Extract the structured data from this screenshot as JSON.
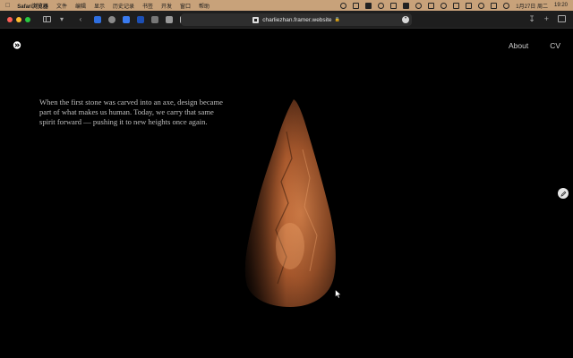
{
  "menubar": {
    "app_name": "Safari浏览器",
    "items": [
      "文件",
      "编辑",
      "显示",
      "历史记录",
      "书签",
      "开发",
      "窗口",
      "帮助"
    ],
    "date": "1月27日 周二",
    "time": "19:20"
  },
  "browser": {
    "url": "charliezhan.framer.website"
  },
  "site": {
    "nav": {
      "about": "About",
      "cv": "CV"
    },
    "hero_text": "When the first stone was carved into an axe, design became part of what makes us human. Today, we carry that same spirit forward — pushing it to new heights once again."
  },
  "icons": {
    "apple": "apple-icon",
    "sidebar": "sidebar-toggle-icon",
    "back": "back-chevron-icon",
    "download": "download-icon",
    "new_tab": "plus-icon",
    "tabs": "tab-overview-icon",
    "edit": "pencil-icon"
  }
}
